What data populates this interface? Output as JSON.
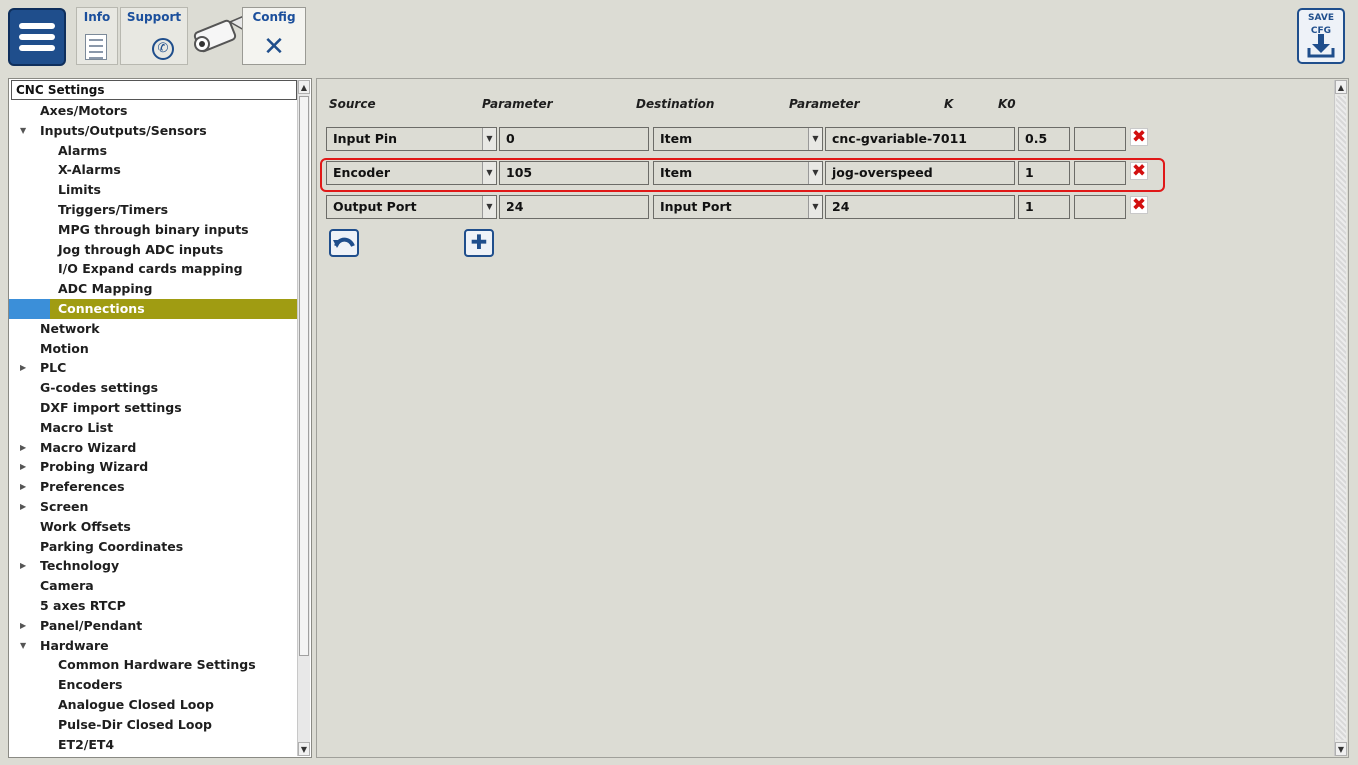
{
  "header": {
    "tabs": [
      {
        "label": "Info",
        "icon": "document-icon"
      },
      {
        "label": "Support",
        "icon": "phone-icon"
      },
      {
        "label": "Config",
        "icon": "tools-icon"
      }
    ],
    "save_button": {
      "line1": "SAVE",
      "line2": "CFG",
      "icon": "download-icon"
    }
  },
  "tree": {
    "header": "CNC Settings",
    "items": [
      {
        "label": "Axes/Motors",
        "level": 1,
        "arrow": ""
      },
      {
        "label": "Inputs/Outputs/Sensors",
        "level": 1,
        "arrow": "expanded"
      },
      {
        "label": "Alarms",
        "level": 2
      },
      {
        "label": "X-Alarms",
        "level": 2
      },
      {
        "label": "Limits",
        "level": 2
      },
      {
        "label": "Triggers/Timers",
        "level": 2
      },
      {
        "label": "MPG through binary inputs",
        "level": 2
      },
      {
        "label": "Jog through ADC inputs",
        "level": 2
      },
      {
        "label": "I/O Expand cards mapping",
        "level": 2
      },
      {
        "label": "ADC Mapping",
        "level": 2
      },
      {
        "label": "Connections",
        "level": 2,
        "selected": true
      },
      {
        "label": "Network",
        "level": 1
      },
      {
        "label": "Motion",
        "level": 1
      },
      {
        "label": "PLC",
        "level": 1,
        "arrow": "collapsed"
      },
      {
        "label": "G-codes settings",
        "level": 1
      },
      {
        "label": "DXF import settings",
        "level": 1
      },
      {
        "label": "Macro List",
        "level": 1
      },
      {
        "label": "Macro Wizard",
        "level": 1,
        "arrow": "collapsed"
      },
      {
        "label": "Probing Wizard",
        "level": 1,
        "arrow": "collapsed"
      },
      {
        "label": "Preferences",
        "level": 1,
        "arrow": "collapsed"
      },
      {
        "label": "Screen",
        "level": 1,
        "arrow": "collapsed"
      },
      {
        "label": "Work Offsets",
        "level": 1
      },
      {
        "label": "Parking Coordinates",
        "level": 1
      },
      {
        "label": "Technology",
        "level": 1,
        "arrow": "collapsed"
      },
      {
        "label": "Camera",
        "level": 1
      },
      {
        "label": "5 axes RTCP",
        "level": 1
      },
      {
        "label": "Panel/Pendant",
        "level": 1,
        "arrow": "collapsed"
      },
      {
        "label": "Hardware",
        "level": 1,
        "arrow": "expanded"
      },
      {
        "label": "Common Hardware Settings",
        "level": 2
      },
      {
        "label": "Encoders",
        "level": 2
      },
      {
        "label": "Analogue Closed Loop",
        "level": 2
      },
      {
        "label": "Pulse-Dir Closed Loop",
        "level": 2
      },
      {
        "label": "ET2/ET4",
        "level": 2
      }
    ]
  },
  "connections": {
    "columns": {
      "source": "Source",
      "parameter1": "Parameter",
      "destination": "Destination",
      "parameter2": "Parameter",
      "k": "K",
      "k0": "K0"
    },
    "rows": [
      {
        "source": "Input Pin",
        "param1": "0",
        "destination": "Item",
        "param2": "cnc-gvariable-7011",
        "k": "0.5",
        "k0": ""
      },
      {
        "source": "Encoder",
        "param1": "105",
        "destination": "Item",
        "param2": "jog-overspeed",
        "k": "1",
        "k0": "",
        "highlighted": true
      },
      {
        "source": "Output Port",
        "param1": "24",
        "destination": "Input Port",
        "param2": "24",
        "k": "1",
        "k0": ""
      }
    ],
    "delete_glyph": "✖",
    "undo_icon": "undo-icon",
    "add_icon": "plus-icon"
  },
  "colors": {
    "accent": "#1f4e8c",
    "selected_bg": "#a09c12",
    "highlight": "#e01818",
    "delete": "#d20f0f"
  }
}
